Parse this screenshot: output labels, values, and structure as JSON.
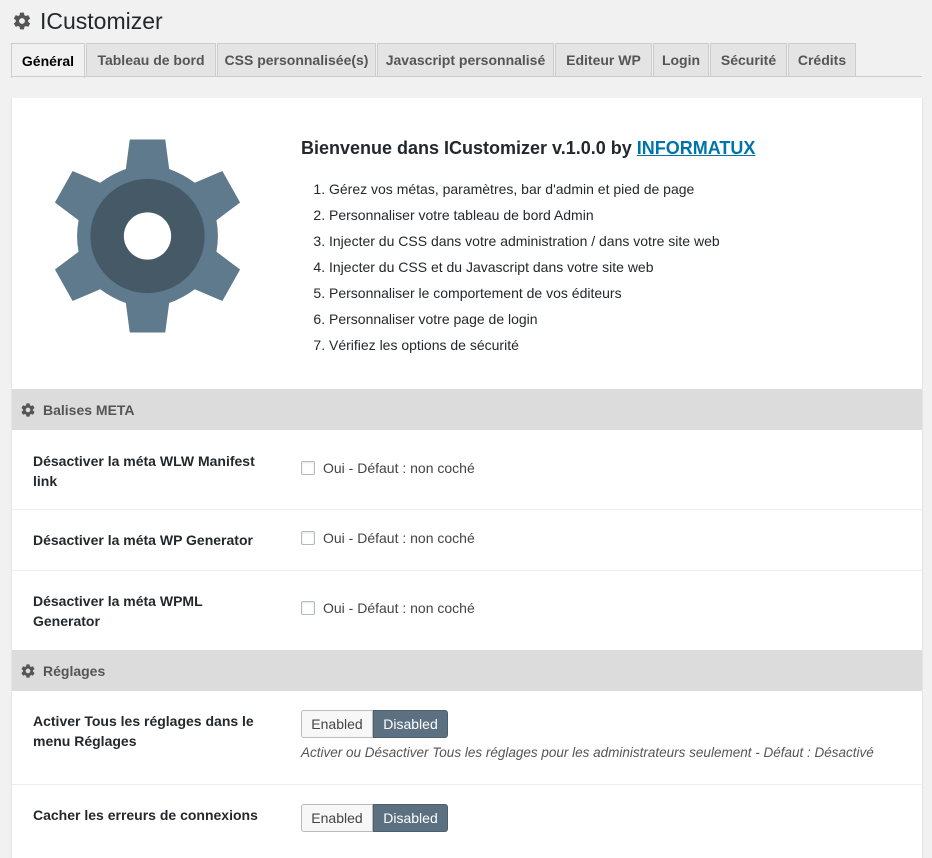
{
  "page": {
    "title": "ICustomizer"
  },
  "tabs": [
    {
      "label": "Général",
      "active": true
    },
    {
      "label": "Tableau de bord"
    },
    {
      "label": "CSS personnalisée(s)"
    },
    {
      "label": "Javascript personnalisé"
    },
    {
      "label": "Editeur WP"
    },
    {
      "label": "Login"
    },
    {
      "label": "Sécurité"
    },
    {
      "label": "Crédits"
    }
  ],
  "welcome": {
    "text": "Bienvenue dans ICustomizer v.1.0.0 by ",
    "link": "INFORMATUX",
    "steps": [
      "Gérez vos métas, paramètres, bar d'admin et pied de page",
      "Personnaliser votre tableau de bord Admin",
      "Injecter du CSS dans votre administration / dans votre site web",
      "Injecter du CSS et du Javascript dans votre site web",
      "Personnaliser le comportement de vos éditeurs",
      "Personnaliser votre page de login",
      "Vérifiez les options de sécurité"
    ]
  },
  "sections": {
    "meta": {
      "title": "Balises META",
      "rows": [
        {
          "label": "Désactiver la méta WLW Manifest link",
          "option": "Oui - Défaut : non coché"
        },
        {
          "label": "Désactiver la méta WP Generator",
          "option": "Oui - Défaut : non coché"
        },
        {
          "label": "Désactiver la méta WPML Generator",
          "option": "Oui - Défaut : non coché"
        }
      ]
    },
    "settings": {
      "title": "Réglages",
      "rows": [
        {
          "label": "Activer Tous les réglages dans le menu Réglages",
          "enabled": "Enabled",
          "disabled": "Disabled",
          "description": "Activer ou Désactiver Tous les réglages pour les administrateurs seulement - Défaut : Désactivé"
        },
        {
          "label": "Cacher les erreurs de connexions",
          "enabled": "Enabled",
          "disabled": "Disabled"
        }
      ]
    }
  },
  "colors": {
    "gear_outer": "#5f7a8c",
    "gear_inner": "#465967",
    "link": "#0073aa",
    "toggle_active": "#5b7080"
  }
}
